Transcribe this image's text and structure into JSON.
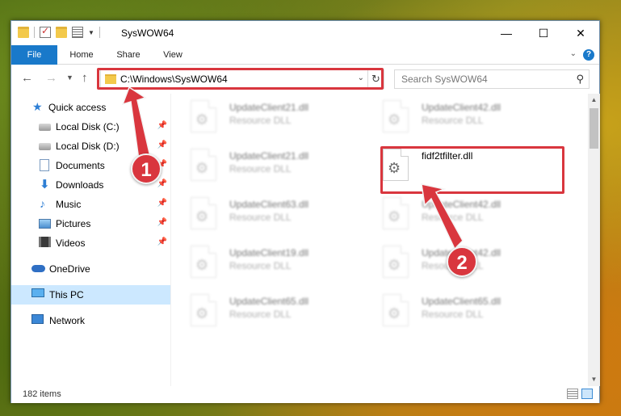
{
  "window": {
    "title": "SysWOW64",
    "controls": {
      "minimize": "—",
      "maximize": "☐",
      "close": "✕"
    }
  },
  "ribbon": {
    "tabs": [
      {
        "label": "File"
      },
      {
        "label": "Home"
      },
      {
        "label": "Share"
      },
      {
        "label": "View"
      }
    ],
    "help": "?"
  },
  "address": {
    "path": "C:\\Windows\\SysWOW64",
    "search_placeholder": "Search SysWOW64"
  },
  "sidebar": {
    "items": [
      {
        "label": "Quick access",
        "icon": "star-icon"
      },
      {
        "label": "Local Disk (C:)",
        "icon": "disk-icon",
        "pinned": true
      },
      {
        "label": "Local Disk (D:)",
        "icon": "disk-icon",
        "pinned": true
      },
      {
        "label": "Documents",
        "icon": "document-icon",
        "pinned": true
      },
      {
        "label": "Downloads",
        "icon": "download-icon",
        "pinned": true
      },
      {
        "label": "Music",
        "icon": "music-icon",
        "pinned": true
      },
      {
        "label": "Pictures",
        "icon": "pictures-icon",
        "pinned": true
      },
      {
        "label": "Videos",
        "icon": "videos-icon",
        "pinned": true
      },
      {
        "label": "OneDrive",
        "icon": "cloud-icon"
      },
      {
        "label": "This PC",
        "icon": "computer-icon",
        "selected": true
      },
      {
        "label": "Network",
        "icon": "network-icon"
      }
    ]
  },
  "files": [
    {
      "name": "UpdateClient21.dll",
      "type": "Resource DLL",
      "blurred": true
    },
    {
      "name": "UpdateClient42.dll",
      "type": "Resource DLL",
      "blurred": true
    },
    {
      "name": "UpdateClient21.dll",
      "type": "Resource DLL",
      "blurred": true
    },
    {
      "name": "fidf2tfilter.dll",
      "type": "",
      "blurred": false
    },
    {
      "name": "UpdateClient63.dll",
      "type": "Resource DLL",
      "blurred": true
    },
    {
      "name": "UpdateClient42.dll",
      "type": "Resource DLL",
      "blurred": true
    },
    {
      "name": "UpdateClient19.dll",
      "type": "Resource DLL",
      "blurred": true
    },
    {
      "name": "UpdateClient42.dll",
      "type": "Resource DLL",
      "blurred": true
    },
    {
      "name": "UpdateClient65.dll",
      "type": "Resource DLL",
      "blurred": true
    },
    {
      "name": "UpdateClient65.dll",
      "type": "Resource DLL",
      "blurred": true
    }
  ],
  "status": {
    "item_count": "182 items"
  },
  "annotations": {
    "step1": "1",
    "step2": "2",
    "color": "#d9363e"
  }
}
